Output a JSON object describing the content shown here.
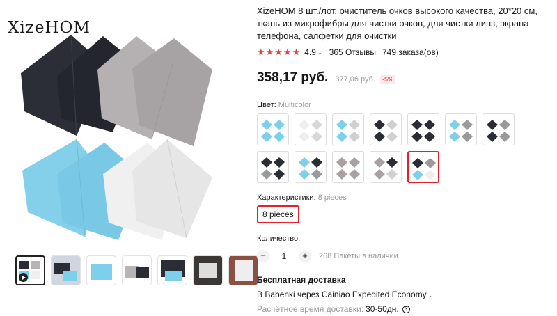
{
  "gallery": {
    "brand": "XizeHOM",
    "thumbnail_count": 7
  },
  "product": {
    "title": "XizeHOM 8 шт./лот, очиститель очков высокого качества, 20*20 см, ткань из микрофибры для чистки очков, для чистки линз, экрана телефона, салфетки для очистки",
    "stars": "★★★★★",
    "rating": "4.9",
    "reviews": "365 Отзывы",
    "orders": "749 заказа(ов)"
  },
  "price": {
    "current": "358,17 руб.",
    "old": "377,06 руб.",
    "discount": "-5%"
  },
  "color": {
    "label": "Цвет:",
    "value": "Multicolor",
    "selected_index": 11,
    "variants": [
      [
        "#7dd0ec",
        "#7dd0ec",
        "#7dd0ec",
        "#7dd0ec"
      ],
      [
        "#eeeeee",
        "#d8d8d8",
        "#eeeeee",
        "#d8d8d8"
      ],
      [
        "#7dd0ec",
        "#d0d0d0",
        "#7dd0ec",
        "#d0d0d0"
      ],
      [
        "#2a2d35",
        "#d0d0d0",
        "#2a2d35",
        "#d0d0d0"
      ],
      [
        "#2a2d35",
        "#2a2d35",
        "#2a2d35",
        "#2a2d35"
      ],
      [
        "#7dd0ec",
        "#9a9a9a",
        "#7dd0ec",
        "#9a9a9a"
      ],
      [
        "#2a2d35",
        "#9a9a9a",
        "#2a2d35",
        "#9a9a9a"
      ],
      [
        "#2a2d35",
        "#2a2d35",
        "#9a9a9a",
        "#2a2d35"
      ],
      [
        "#7dd0ec",
        "#2a2d35",
        "#7dd0ec",
        "#9a9a9a"
      ],
      [
        "#a9a0a2",
        "#a9a0a2",
        "#a9a0a2",
        "#a9a0a2"
      ],
      [
        "#a9a0a2",
        "#2a2d35",
        "#a9a0a2",
        "#d0d0d0"
      ],
      [
        "#2a2d35",
        "#9a9a9a",
        "#7dd0ec",
        "#eeeeee"
      ]
    ]
  },
  "specs": {
    "label": "Характеристики:",
    "value": "8 pieces",
    "selected": "8 pieces"
  },
  "quantity": {
    "label": "Количество:",
    "minus": "−",
    "value": "1",
    "plus": "+",
    "stock": "268 Пакеты в наличии"
  },
  "shipping": {
    "title": "Бесплатная доставка",
    "method": "В Babenki через Cainiao Expedited Economy",
    "time_label": "Расчётное время доставки:",
    "time_value": "30-50дн."
  },
  "icons": {
    "caret": "⌄",
    "help": "?"
  }
}
